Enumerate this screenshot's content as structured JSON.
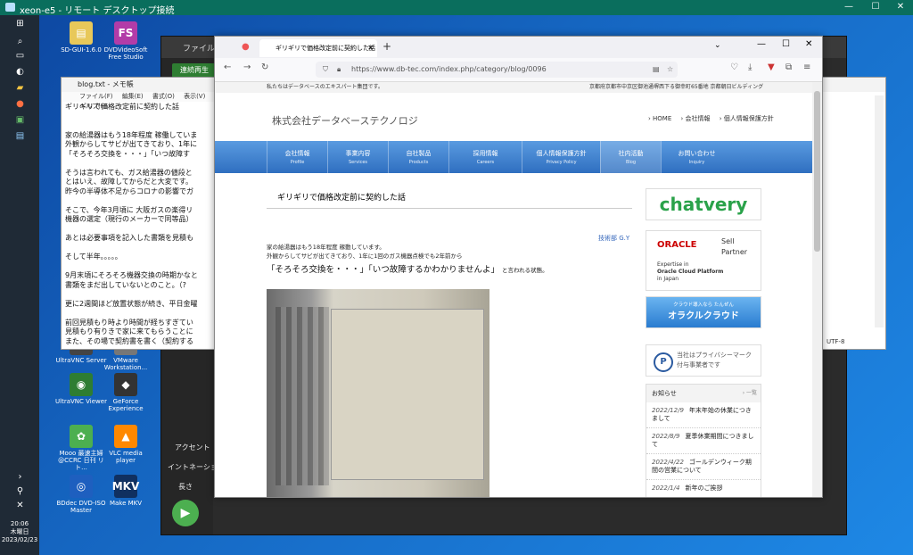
{
  "rd": {
    "title": "xeon-e5 - リモート デスクトップ接続",
    "min": "—",
    "max": "☐",
    "close": "✕"
  },
  "taskbar": {
    "time": "20:06",
    "day": "木曜日",
    "date": "2023/02/23"
  },
  "desktop_icons": [
    {
      "label": "SD-GUI-1.6.0",
      "color": "#e8c85a",
      "glyph": "▤"
    },
    {
      "label": "DVDVideoSoft Free Studio",
      "color": "#b23ca8",
      "glyph": "FS"
    },
    {
      "label": "UltraVNC Server",
      "color": "#444444",
      "glyph": "▣"
    },
    {
      "label": "VMware Workstation...",
      "color": "#777777",
      "glyph": "▢"
    },
    {
      "label": "UltraVNC Viewer",
      "color": "#2e7d32",
      "glyph": "◉"
    },
    {
      "label": "GeForce Experience",
      "color": "#333333",
      "glyph": "◆"
    },
    {
      "label": "Mooo 最速主婦 @CCRC 日刊 リト...",
      "color": "#4caf50",
      "glyph": "✿"
    },
    {
      "label": "VLC media player",
      "color": "#ff8800",
      "glyph": "▲"
    },
    {
      "label": "BDdec DVD-ISO Master",
      "color": "#1e5fbf",
      "glyph": "◎"
    },
    {
      "label": "Make MKV",
      "color": "#103060",
      "glyph": "MKV"
    }
  ],
  "darkwin": {
    "menu_file": "ファイル",
    "btn": "連続再生",
    "side1": "アクセント",
    "side2": "イントネーション",
    "side3": "長さ",
    "play": "▶"
  },
  "notepad": {
    "title": "blog.txt - メモ帳",
    "menu": [
      "ファイル(F)",
      "編集(E)",
      "書式(O)",
      "表示(V)",
      "ヘルプ(H)"
    ],
    "lines": [
      "ギリギリで価格改定前に契約した話",
      "",
      "",
      "家の給湯器はもう18年程度 稼働していま",
      "外観からしてサビが出てきており、1年に",
      "「そろそろ交換を・・・」「いつ故障す",
      "",
      "そうは言われても、ガス給湯器の値段と",
      "とはいえ、故障してからだと大変です。",
      "昨今の半導体不足からコロナの影響でガ",
      "",
      "そこで、今年3月頃に 大阪ガスの楽得リ",
      "機器の選定（現行のメーカーで同等品）",
      "",
      "あとは必要事項を記入した書類を見積も",
      "",
      "そして半年。。。。。",
      "",
      "9月末頃にそろそろ機器交換の時期かなと",
      "書類をまだ出していないとのこと。（?",
      "",
      "更に2週間ほど放置状態が続き、平日金曜",
      "",
      "前回見積もり時より時間が経ちすぎてい",
      "見積もり有りきで家に来てもらうことに",
      "また、その場で契約書を書く（契約する"
    ],
    "status": "UTF-8"
  },
  "browser": {
    "tab_title": "ギリギリで価格改定前に契約した話",
    "url": "https://www.db-tec.com/index.php/category/blog/0096",
    "strip": "私たちはデータベースのエキスパート集団です。",
    "strip_right": "京都府京都市中京区御池通堺西下る御幸町65番地 京都朝日ビルディング",
    "site_name": "株式会社データベーステクノロジ",
    "toplinks": [
      "› HOME",
      "› 会社情報",
      "› 個人情報保護方針"
    ],
    "nav": [
      {
        "j": "会社情報",
        "e": "Profile"
      },
      {
        "j": "事業内容",
        "e": "Services"
      },
      {
        "j": "自社製品",
        "e": "Products"
      },
      {
        "j": "採用情報",
        "e": "Careers"
      },
      {
        "j": "個人情報保護方針",
        "e": "Privacy Policy"
      },
      {
        "j": "社内活動",
        "e": "Blog"
      },
      {
        "j": "お問い合わせ",
        "e": "Inquiry"
      }
    ],
    "post_title": "ギリギリで価格改定前に契約した話",
    "author": "技術部 G.Y",
    "p1": "家の給湯器はもう18年程度 稼動しています。",
    "p2": "外観からしてサビが出てきており、1年に1回のガス機器点検でも2年前から",
    "quote": "「そろそろ交換を・・・」「いつ故障するかわかりませんよ」",
    "quote_tail": "と言われる状態。",
    "chatvery": "chatvery",
    "oracle": "ORACLE",
    "oracle_sp": [
      "Sell",
      "Partner"
    ],
    "oracle_ex": [
      "Expertise in",
      "Oracle Cloud Platform",
      "in Japan"
    ],
    "ocloud_small": "クラウド導入なら たんぜん",
    "ocloud": "オラクルクラウド",
    "pmark": [
      "当社はプライバシーマーク",
      "付与事業者です"
    ],
    "news_head": "お知らせ",
    "news_more": "› 一覧",
    "news": [
      {
        "d": "2022/12/9",
        "t": "年末年始の休業につきまして"
      },
      {
        "d": "2022/8/9",
        "t": "夏季休業期間につきまして"
      },
      {
        "d": "2022/4/22",
        "t": "ゴールデンウィーク期間の営業について"
      },
      {
        "d": "2022/1/4",
        "t": "新年のご挨拶"
      }
    ]
  }
}
